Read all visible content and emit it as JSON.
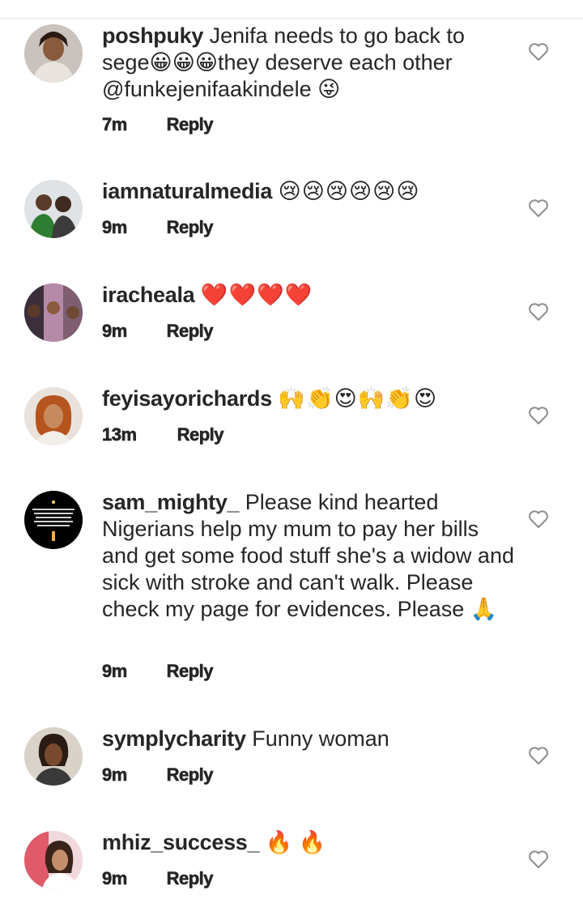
{
  "comments": [
    {
      "username": "poshpuky",
      "text": "Jenifa needs to go back to sege😀😀😀they deserve each other @funkejenifaakindele 😜",
      "time": "7m",
      "reply": "Reply",
      "avatar_icon": "avatar-photo-woman"
    },
    {
      "username": "iamnaturalmedia",
      "text": "😢😢😢😢😢😢",
      "time": "9m",
      "reply": "Reply",
      "avatar_icon": "avatar-photo-two-men"
    },
    {
      "username": "iracheala",
      "text": "❤️❤️❤️❤️",
      "time": "9m",
      "reply": "Reply",
      "avatar_icon": "avatar-photo-collage"
    },
    {
      "username": "feyisayorichards",
      "text": "🙌👏😍🙌👏😍",
      "time": "13m",
      "reply": "Reply",
      "avatar_icon": "avatar-photo-woman"
    },
    {
      "username": "sam_mighty_",
      "text": "Please kind hearted Nigerians help my mum to pay her bills and get some food stuff she's a widow and sick with stroke and can't walk. Please check my page for evidences. Please 🙏",
      "time": "9m",
      "reply": "Reply",
      "avatar_icon": "avatar-quote-image"
    },
    {
      "username": "symplycharity",
      "text": "Funny woman",
      "time": "9m",
      "reply": "Reply",
      "avatar_icon": "avatar-photo-woman"
    },
    {
      "username": "mhiz_success_",
      "text": "🔥 🔥",
      "time": "9m",
      "reply": "Reply",
      "avatar_icon": "avatar-photo-woman"
    }
  ],
  "like_icon": "heart-outline-icon",
  "colors": {
    "text": "#262626",
    "icon": "#8e8e8e",
    "divider": "#e6e6e6"
  }
}
